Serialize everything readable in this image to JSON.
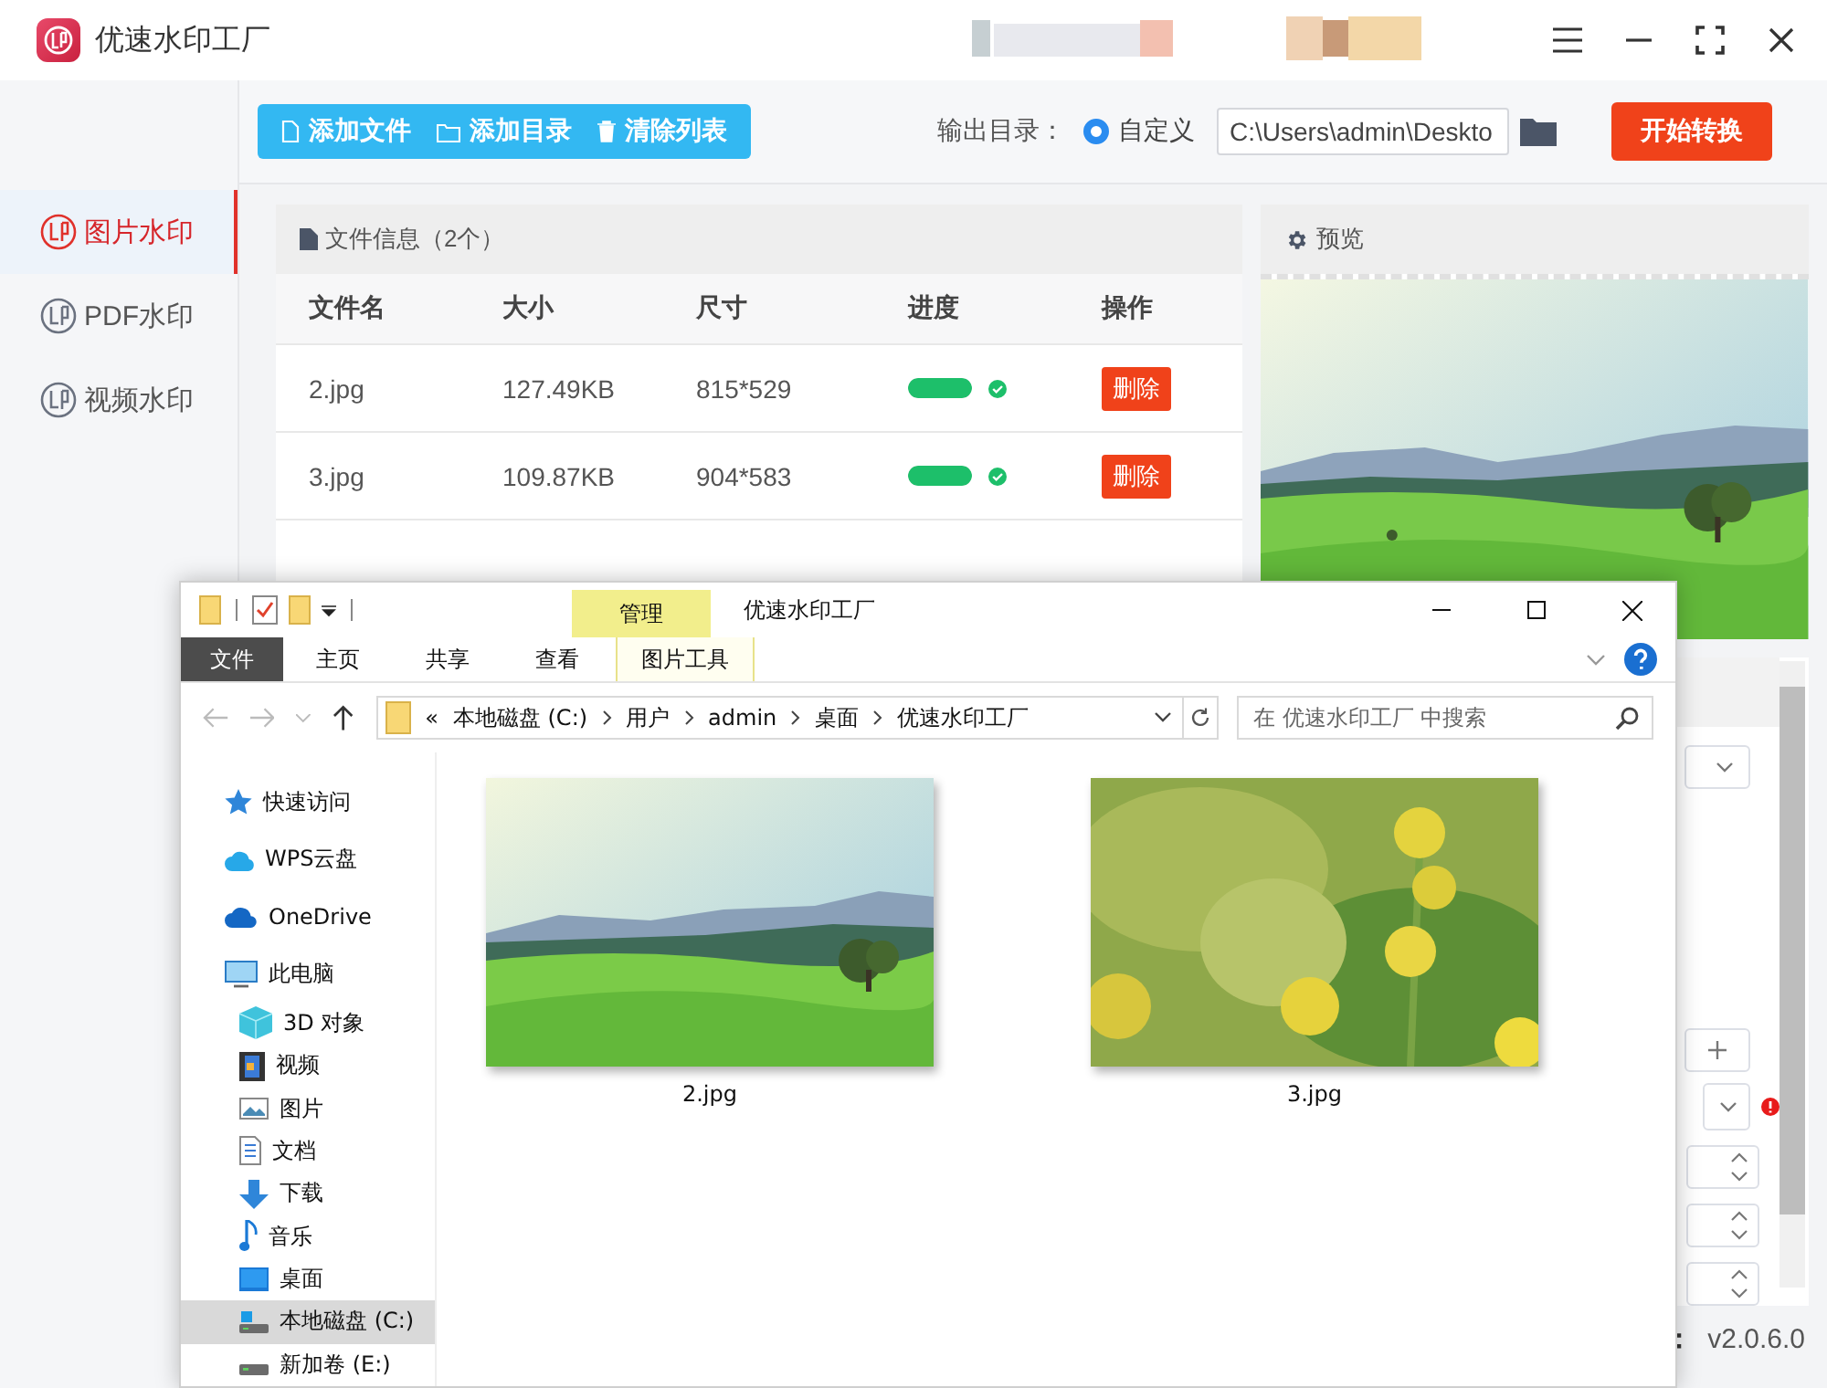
{
  "app": {
    "title": "优速水印工厂"
  },
  "sidebar": {
    "items": [
      {
        "label": "图片水印",
        "selected": true
      },
      {
        "label": "PDF水印",
        "selected": false
      },
      {
        "label": "视频水印",
        "selected": false
      }
    ]
  },
  "toolbar": {
    "buttons": [
      "添加文件",
      "添加目录",
      "清除列表"
    ]
  },
  "output": {
    "label": "输出目录：",
    "option": {
      "label": "自定义",
      "selected": true
    },
    "path": "C:\\Users\\admin\\Deskto"
  },
  "start_button": "开始转换",
  "file_panel": {
    "title": "文件信息（2个）",
    "columns": [
      "文件名",
      "大小",
      "尺寸",
      "进度",
      "操作"
    ],
    "rows": [
      {
        "name": "2.jpg",
        "size": "127.49KB",
        "dimensions": "815*529",
        "level": 1,
        "done": true,
        "action": "删除"
      },
      {
        "name": "3.jpg",
        "size": "109.87KB",
        "dimensions": "904*583",
        "level": 1,
        "done": true,
        "action": "删除"
      }
    ]
  },
  "preview": {
    "title": "预览",
    "kind": "picture"
  },
  "status_bar": {
    "label_end": "：",
    "version": "v2.0.6.0"
  },
  "explorer": {
    "context_tab": "管理",
    "title": "优速水印工厂",
    "ribbon_tabs": [
      {
        "label": "文件",
        "kind": "file_menu",
        "selected": false
      },
      {
        "label": "主页",
        "kind": "tab",
        "selected": false
      },
      {
        "label": "共享",
        "kind": "tab",
        "selected": false
      },
      {
        "label": "查看",
        "kind": "tab",
        "selected": false
      },
      {
        "label": "图片工具",
        "kind": "context",
        "selected": false
      }
    ],
    "address": {
      "overflow": "«",
      "crumbs": [
        "本地磁盘 (C:)",
        "用户",
        "admin",
        "桌面",
        "优速水印工厂"
      ]
    },
    "search": {
      "placeholder": "在 优速水印工厂 中搜索"
    },
    "nav": [
      {
        "label": "快速访问",
        "selected": false
      },
      {
        "label": "WPS云盘",
        "selected": false
      },
      {
        "label": "OneDrive",
        "selected": false
      },
      {
        "label": "此电脑",
        "selected": false,
        "children": [
          {
            "label": "3D 对象",
            "selected": false
          },
          {
            "label": "视频",
            "selected": false
          },
          {
            "label": "图片",
            "selected": false
          },
          {
            "label": "文档",
            "selected": false
          },
          {
            "label": "下载",
            "selected": false
          },
          {
            "label": "音乐",
            "selected": false
          },
          {
            "label": "桌面",
            "selected": false
          },
          {
            "label": "本地磁盘 (C:)",
            "selected": true
          },
          {
            "label": "新加卷 (E:)",
            "selected": false
          }
        ]
      }
    ],
    "files": [
      {
        "name": "2.jpg",
        "kind": "picture"
      },
      {
        "name": "3.jpg",
        "kind": "picture"
      }
    ]
  }
}
